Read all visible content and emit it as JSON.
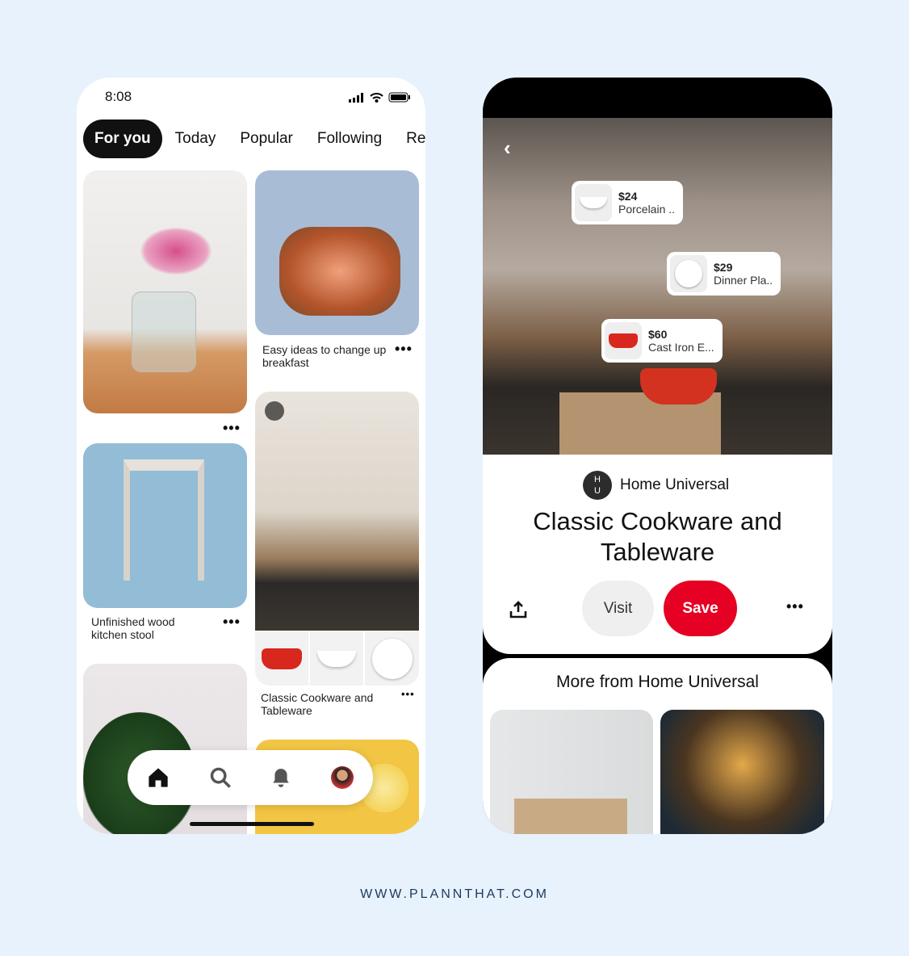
{
  "left_phone": {
    "status": {
      "time": "8:08"
    },
    "tabs": [
      "For you",
      "Today",
      "Popular",
      "Following",
      "Re"
    ],
    "pins": [
      {
        "caption": ""
      },
      {
        "caption": "Easy ideas to change up breakfast"
      },
      {
        "caption": "Unfinished wood kitchen stool"
      },
      {
        "caption": "Classic Cookware and Tableware"
      },
      {
        "caption": ""
      },
      {
        "caption": ""
      }
    ],
    "more_label": "•••",
    "nav": [
      "home-icon",
      "search-icon",
      "bell-icon",
      "profile-avatar"
    ]
  },
  "right_phone": {
    "product_tags": [
      {
        "price": "$24",
        "name": "Porcelain .."
      },
      {
        "price": "$29",
        "name": "Dinner Pla.."
      },
      {
        "price": "$60",
        "name": "Cast Iron E..."
      }
    ],
    "creator": {
      "name": "Home Universal",
      "avatar_initials": "H U"
    },
    "title": "Classic Cookware and Tableware",
    "visit_label": "Visit",
    "save_label": "Save",
    "more_label": "•••",
    "more_from": "More from Home Universal",
    "colors": {
      "save": "#e60023",
      "visit": "#efefef"
    }
  },
  "footer": "WWW.PLANNTHAT.COM"
}
